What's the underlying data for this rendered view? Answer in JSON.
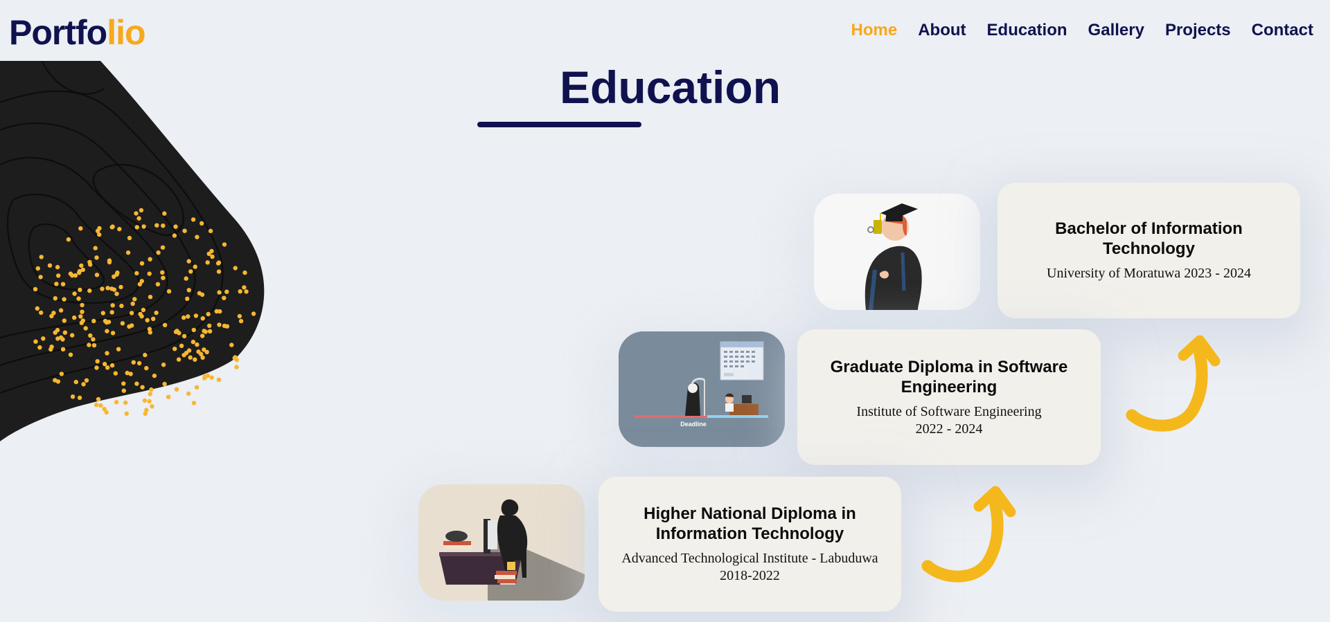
{
  "logo": {
    "part1": "Portfo",
    "part2": "lio"
  },
  "nav": {
    "items": [
      "Home",
      "About",
      "Education",
      "Gallery",
      "Projects",
      "Contact"
    ],
    "active": "Home"
  },
  "section": {
    "title": "Education"
  },
  "education": [
    {
      "degree": "Bachelor of Information Technology",
      "details": "University of Moratuwa 2023 - 2024",
      "illustration": "graduate-icon"
    },
    {
      "degree": "Graduate Diploma in Software Engineering",
      "details": "Institute of Software Engineering 2022 - 2024",
      "illustration": "deadline-icon",
      "illustration_text": "Deadline"
    },
    {
      "degree": "Higher National Diploma in Information Technology",
      "details": "Advanced Technological Institute - Labuduwa 2018-2022",
      "illustration": "study-desk-icon"
    }
  ],
  "colors": {
    "navy": "#10124f",
    "accent": "#f7a81b",
    "blob": "#1d1d1d",
    "card": "#f2f0eb"
  }
}
